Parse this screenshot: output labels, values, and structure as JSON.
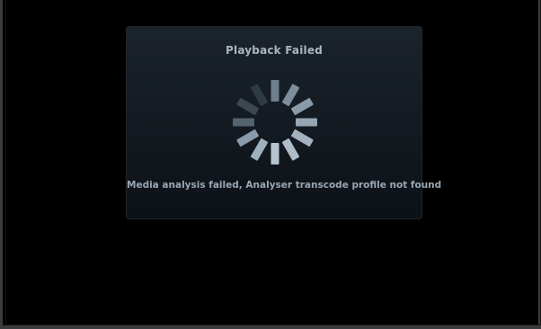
{
  "dialog": {
    "title": "Playback Failed",
    "message": "Media analysis failed, Analyser transcode profile not found"
  },
  "spinner": {
    "icon": "loading-spinner-icon",
    "segments": 12,
    "colors": {
      "light": "#b9c8d6",
      "dark": "#2c3740"
    }
  }
}
